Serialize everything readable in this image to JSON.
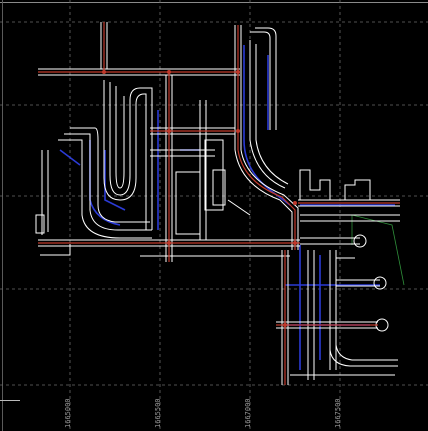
{
  "window": {
    "title": ""
  },
  "grid_labels": [
    "1665000",
    "1665500",
    "1667000",
    "1667500"
  ],
  "colors": {
    "background": "#000000",
    "grid": "#6b6b6b",
    "road_edge": "#ffffff",
    "centerline": "#c0392b",
    "pipe": "#2b3bd6",
    "green_boundary": "#2f8f3a"
  },
  "icons": [
    "crosshair-cursor-icon"
  ]
}
